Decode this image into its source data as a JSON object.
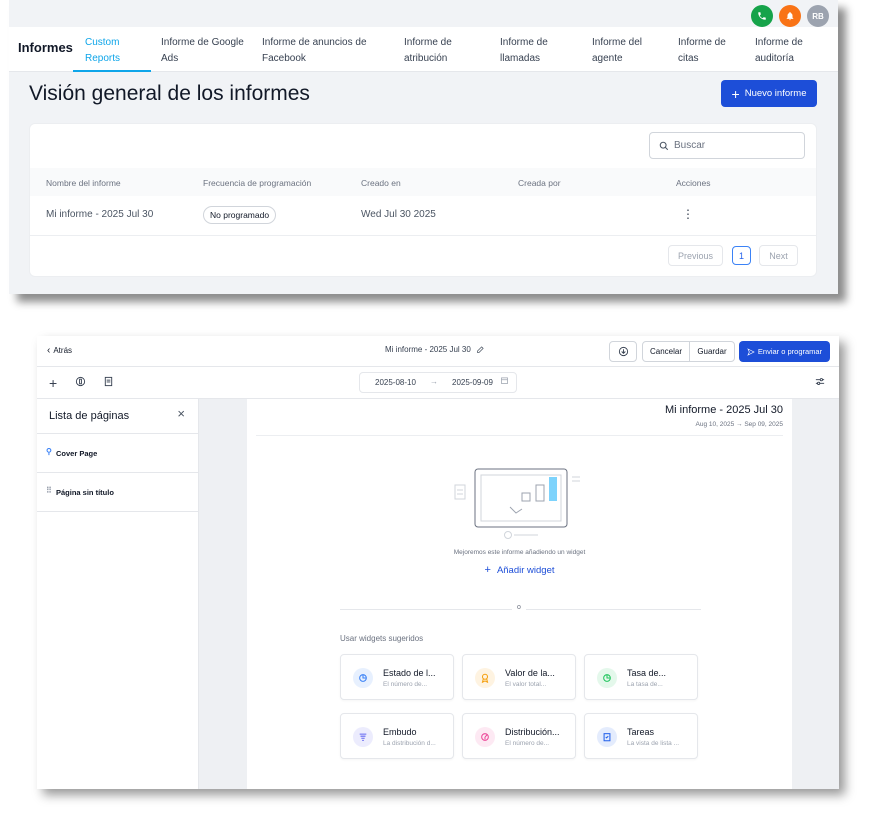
{
  "reports_list": {
    "header": {
      "brand": "Informes",
      "tabs": [
        {
          "line1": "Custom",
          "line2": "Reports"
        },
        {
          "line1": "Informe de Google",
          "line2": "Ads"
        },
        {
          "line1": "Informe de anuncios de",
          "line2": "Facebook"
        },
        {
          "line1": "Informe de",
          "line2": "atribución"
        },
        {
          "line1": "Informe de",
          "line2": "llamadas"
        },
        {
          "line1": "Informe del",
          "line2": "agente"
        },
        {
          "line1": "Informe de",
          "line2": "citas"
        },
        {
          "line1": "Informe de",
          "line2": "auditoría"
        }
      ],
      "avatar_initials": "RB"
    },
    "page_title": "Visión general de los informes",
    "new_report_label": "Nuevo informe",
    "search_placeholder": "Buscar",
    "table": {
      "columns": [
        "Nombre del informe",
        "Frecuencia de programación",
        "Creado en",
        "Creada por",
        "Acciones"
      ],
      "rows": [
        {
          "name": "Mi informe - 2025 Jul 30",
          "frequency": "No programado",
          "created_at": "Wed Jul 30 2025",
          "created_by": "",
          "actions": "⋮"
        }
      ]
    },
    "pagination": {
      "previous": "Previous",
      "current": "1",
      "next": "Next"
    }
  },
  "editor": {
    "back_label": "Atrás",
    "report_title": "Mi informe - 2025 Jul 30",
    "cancel_label": "Cancelar",
    "save_label": "Guardar",
    "send_label": "Enviar o programar",
    "date_from": "2025-08-10",
    "date_to": "2025-09-09",
    "sidebar": {
      "title": "Lista de páginas",
      "pages": [
        "Cover Page",
        "Página sin título"
      ]
    },
    "canvas": {
      "title": "Mi informe - 2025 Jul 30",
      "date_range": "Aug 10, 2025 → Sep 09, 2025",
      "empty_message": "Mejoremos este informe añadiendo un widget",
      "add_widget_label": "Añadir widget",
      "divider_label": "o",
      "suggested_label": "Usar widgets sugeridos",
      "widgets": [
        {
          "title": "Estado de l...",
          "subtitle": "El número de...",
          "icon": "pie-chart-icon",
          "color": "#3b82f6"
        },
        {
          "title": "Valor de la...",
          "subtitle": "El valor total...",
          "icon": "award-icon",
          "color": "#f59e0b"
        },
        {
          "title": "Tasa de...",
          "subtitle": "La tasa de...",
          "icon": "pie-chart-icon",
          "color": "#22c55e"
        },
        {
          "title": "Embudo",
          "subtitle": "La distribución d...",
          "icon": "funnel-icon",
          "color": "#6366f1"
        },
        {
          "title": "Distribución...",
          "subtitle": "El número de...",
          "icon": "chart-icon",
          "color": "#ec4899"
        },
        {
          "title": "Tareas",
          "subtitle": "La vista de lista ...",
          "icon": "clipboard-icon",
          "color": "#2563eb"
        }
      ]
    }
  }
}
